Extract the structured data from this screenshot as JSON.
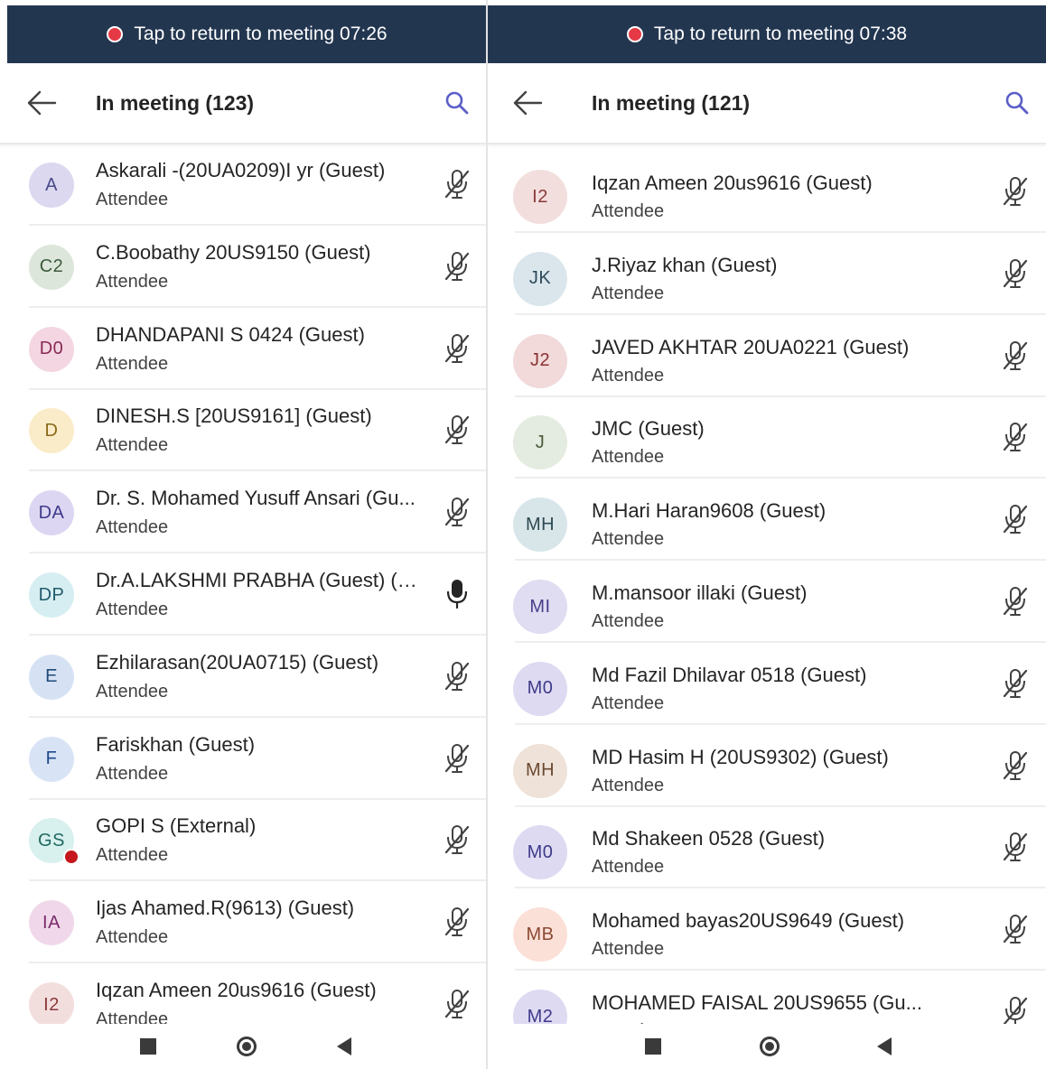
{
  "left": {
    "banner_text": "Tap to return to meeting 07:26",
    "title": "In meeting (123)",
    "participants": [
      {
        "initials": "A",
        "name": "Askarali -(20UA0209)I yr (Guest)",
        "role": "Attendee",
        "avatar_bg": "#dcd8f0",
        "avatar_fg": "#4a4a8a",
        "mic": "muted"
      },
      {
        "initials": "C2",
        "name": "C.Boobathy 20US9150 (Guest)",
        "role": "Attendee",
        "avatar_bg": "#dde6da",
        "avatar_fg": "#3d5a3d",
        "mic": "muted"
      },
      {
        "initials": "D0",
        "name": "DHANDAPANI S 0424 (Guest)",
        "role": "Attendee",
        "avatar_bg": "#f3d6e2",
        "avatar_fg": "#8a2a55",
        "mic": "muted"
      },
      {
        "initials": "D",
        "name": "DINESH.S [20US9161] (Guest)",
        "role": "Attendee",
        "avatar_bg": "#faecc8",
        "avatar_fg": "#8a6a1a",
        "mic": "muted"
      },
      {
        "initials": "DA",
        "name": "Dr. S. Mohamed Yusuff Ansari (Gu...",
        "role": "Attendee",
        "avatar_bg": "#ddd6f2",
        "avatar_fg": "#3e3a8a",
        "mic": "muted"
      },
      {
        "initials": "DP",
        "name": "Dr.A.LAKSHMI PRABHA (Guest) (G...",
        "role": "Attendee",
        "avatar_bg": "#d6eef2",
        "avatar_fg": "#1f5a6a",
        "mic": "on"
      },
      {
        "initials": "E",
        "name": "Ezhilarasan(20UA0715) (Guest)",
        "role": "Attendee",
        "avatar_bg": "#d6e2f4",
        "avatar_fg": "#1f4a7a",
        "mic": "muted"
      },
      {
        "initials": "F",
        "name": "Fariskhan (Guest)",
        "role": "Attendee",
        "avatar_bg": "#d8e4f6",
        "avatar_fg": "#1f4a8a",
        "mic": "muted"
      },
      {
        "initials": "GS",
        "name": "GOPI S (External)",
        "role": "Attendee",
        "avatar_bg": "#d8f0ee",
        "avatar_fg": "#1f6a62",
        "mic": "muted",
        "presence": true
      },
      {
        "initials": "IA",
        "name": "Ijas Ahamed.R(9613) (Guest)",
        "role": "Attendee",
        "avatar_bg": "#f0d8ea",
        "avatar_fg": "#7a2a6a",
        "mic": "muted"
      },
      {
        "initials": "I2",
        "name": "Iqzan Ameen 20us9616  (Guest)",
        "role": "Attendee",
        "avatar_bg": "#f3dede",
        "avatar_fg": "#8a3a3a",
        "mic": "muted"
      }
    ]
  },
  "right": {
    "banner_text": "Tap to return to meeting 07:38",
    "title": "In meeting (121)",
    "participants": [
      {
        "initials": "I2",
        "name": "Iqzan Ameen 20us9616  (Guest)",
        "role": "Attendee",
        "avatar_bg": "#f3dede",
        "avatar_fg": "#8a3a3a",
        "mic": "muted"
      },
      {
        "initials": "JK",
        "name": "J.Riyaz khan (Guest)",
        "role": "Attendee",
        "avatar_bg": "#dae6ec",
        "avatar_fg": "#2e4a5a",
        "mic": "muted"
      },
      {
        "initials": "J2",
        "name": "JAVED AKHTAR 20UA0221 (Guest)",
        "role": "Attendee",
        "avatar_bg": "#f2dada",
        "avatar_fg": "#8a3232",
        "mic": "muted"
      },
      {
        "initials": "J",
        "name": "JMC (Guest)",
        "role": "Attendee",
        "avatar_bg": "#e4ebe0",
        "avatar_fg": "#4a5a3a",
        "mic": "muted"
      },
      {
        "initials": "MH",
        "name": "M.Hari Haran9608 (Guest)",
        "role": "Attendee",
        "avatar_bg": "#d8e6ea",
        "avatar_fg": "#2e4a52",
        "mic": "muted"
      },
      {
        "initials": "MI",
        "name": "M.mansoor illaki (Guest)",
        "role": "Attendee",
        "avatar_bg": "#e0dcf2",
        "avatar_fg": "#46408a",
        "mic": "muted"
      },
      {
        "initials": "M0",
        "name": "Md Fazil Dhilavar 0518 (Guest)",
        "role": "Attendee",
        "avatar_bg": "#dedaf2",
        "avatar_fg": "#3e3a8a",
        "mic": "muted"
      },
      {
        "initials": "MH",
        "name": "MD Hasim H (20US9302) (Guest)",
        "role": "Attendee",
        "avatar_bg": "#efe2d8",
        "avatar_fg": "#6a4a32",
        "mic": "muted"
      },
      {
        "initials": "M0",
        "name": "Md Shakeen 0528 (Guest)",
        "role": "Attendee",
        "avatar_bg": "#dedaf2",
        "avatar_fg": "#3e3a8a",
        "mic": "muted"
      },
      {
        "initials": "MB",
        "name": "Mohamed bayas20US9649 (Guest)",
        "role": "Attendee",
        "avatar_bg": "#fbe0d8",
        "avatar_fg": "#8a4a32",
        "mic": "muted"
      },
      {
        "initials": "M2",
        "name": "MOHAMED FAISAL 20US9655 (Gu...",
        "role": "Attendee",
        "avatar_bg": "#dedaf2",
        "avatar_fg": "#3e3a8a",
        "mic": "muted"
      }
    ]
  },
  "colors": {
    "banner": "#233650",
    "recording_dot": "#e53946",
    "accent": "#5b5fc7",
    "presence_busy": "#c4161c"
  },
  "icons": {
    "back": "arrow-left-icon",
    "search": "search-icon",
    "mic_muted": "mic-off-icon",
    "mic_on": "mic-icon"
  }
}
